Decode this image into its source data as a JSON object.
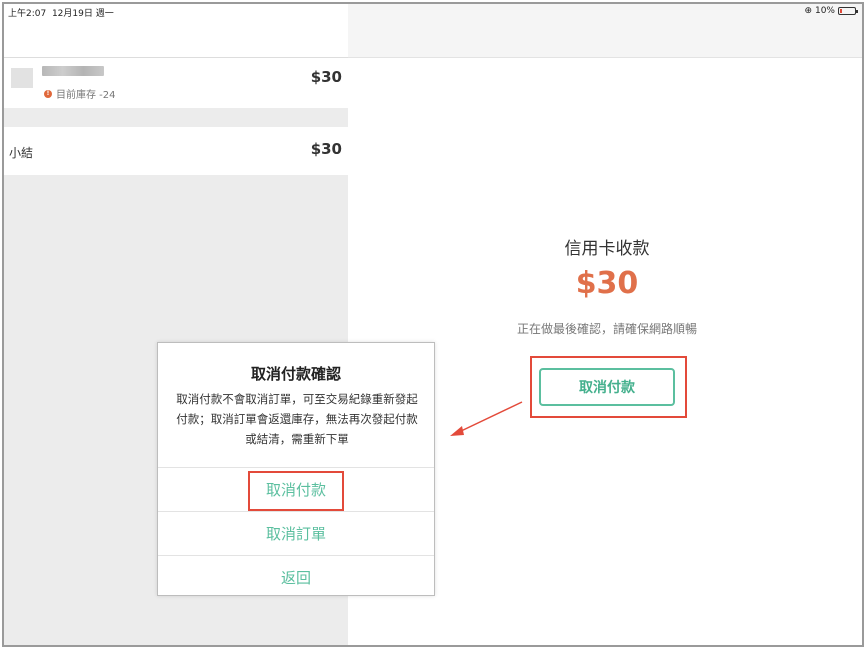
{
  "status_bar": {
    "time": "上午2:07",
    "date": "12月19日 週一",
    "battery": "10%"
  },
  "cart": {
    "item": {
      "stock_warning": "目前庫存 -24",
      "price": "$30"
    },
    "subtotal": {
      "label": "小結",
      "value": "$30"
    }
  },
  "payment": {
    "title": "信用卡收款",
    "amount": "$30",
    "note": "正在做最後確認，請確保網路順暢",
    "cancel_button": "取消付款"
  },
  "dialog": {
    "title": "取消付款確認",
    "message": "取消付款不會取消訂單，可至交易紀錄重新發起付款；取消訂單會返還庫存，無法再次發起付款或結清，需重新下單",
    "options": [
      "取消付款",
      "取消訂單",
      "返回"
    ]
  },
  "colors": {
    "accent_green": "#5bbf9f",
    "amount_orange": "#e0704a",
    "highlight_red": "#e34a3a"
  }
}
